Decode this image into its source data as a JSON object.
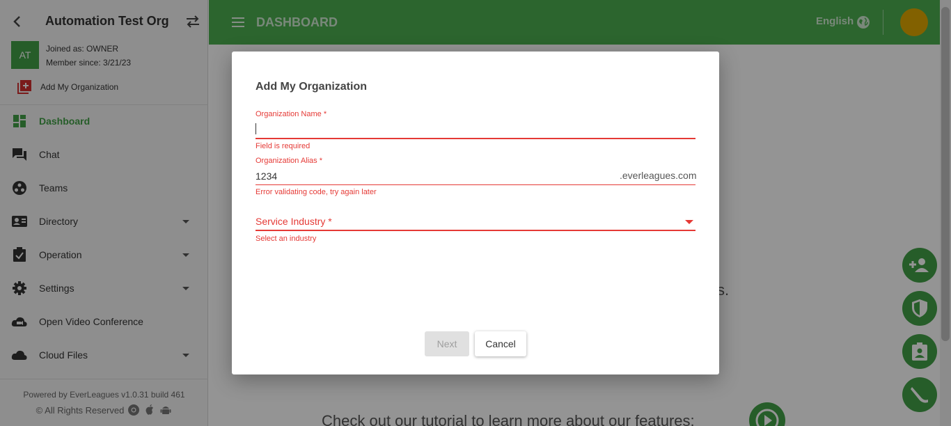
{
  "sidebar": {
    "org_name": "Automation Test Org",
    "avatar_initials": "AT",
    "joined_as": "Joined as: OWNER",
    "member_since": "Member since: 3/21/23",
    "add_org_label": "Add My Organization",
    "items": [
      {
        "label": "Dashboard"
      },
      {
        "label": "Chat"
      },
      {
        "label": "Teams"
      },
      {
        "label": "Directory"
      },
      {
        "label": "Operation"
      },
      {
        "label": "Settings"
      },
      {
        "label": "Open Video Conference"
      },
      {
        "label": "Cloud Files"
      }
    ],
    "footer_powered": "Powered by EverLeagues v1.0.31 build 461",
    "footer_rights": "© All Rights Reserved"
  },
  "topbar": {
    "title": "DASHBOARD",
    "language": "English"
  },
  "main": {
    "partial_text": "s.",
    "tutorial_text": "Check out our tutorial to learn more about our features:"
  },
  "dialog": {
    "title": "Add My Organization",
    "org_name_label": "Organization Name *",
    "org_name_value": "",
    "org_name_error": "Field is required",
    "alias_label": "Organization Alias *",
    "alias_value": "1234",
    "alias_suffix": ".everleagues.com",
    "alias_error": "Error validating code, try again later",
    "industry_label": "Service Industry *",
    "industry_error": "Select an industry",
    "next_label": "Next",
    "cancel_label": "Cancel"
  },
  "colors": {
    "primary_green": "#4caf50",
    "error_red": "#e53935",
    "avatar_gold": "#e0a800"
  }
}
